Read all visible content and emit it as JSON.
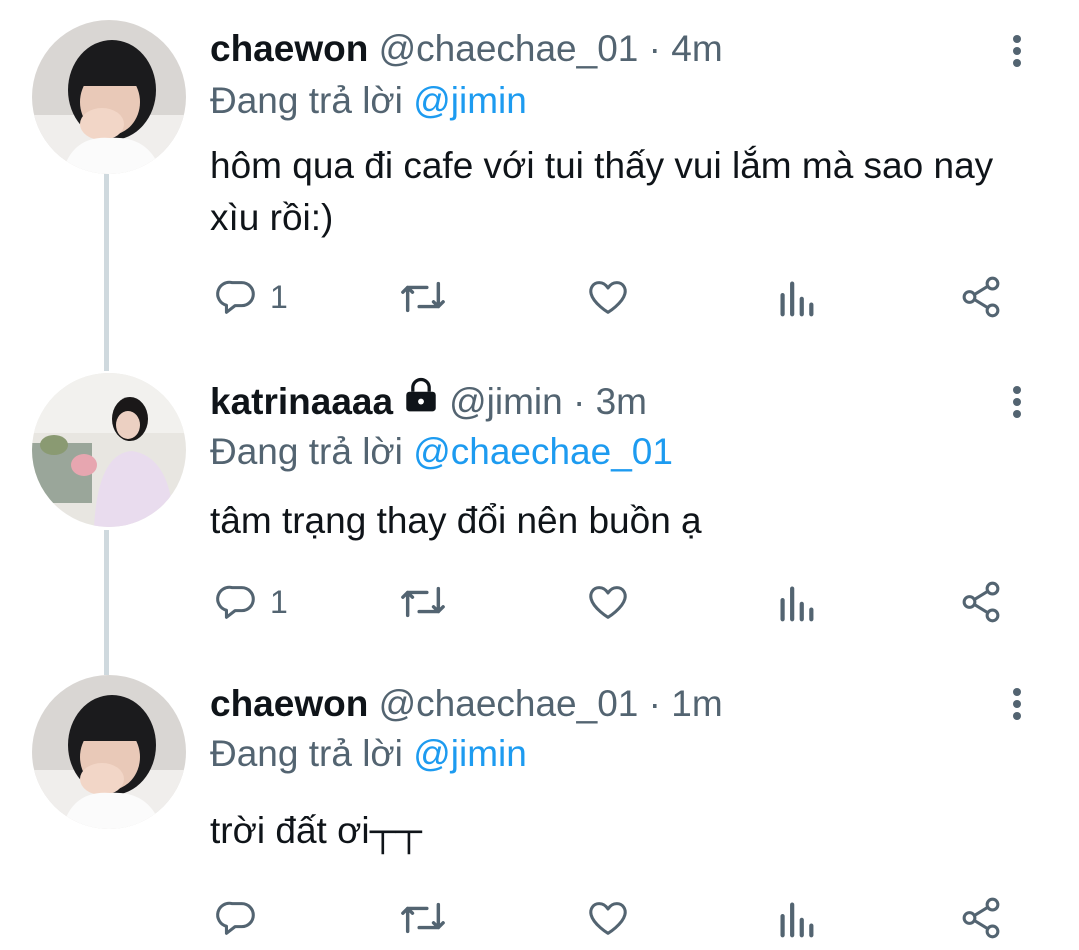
{
  "thread": [
    {
      "display_name": "chaewon",
      "handle": "@chaechae_01",
      "separator": "·",
      "time": "4m",
      "protected": false,
      "reply_prefix": "Đang trả lời",
      "reply_to": "@jimin",
      "text": "hôm qua đi cafe với tui thấy vui lắm mà sao nay xìu rồi:)",
      "reply_count": "1"
    },
    {
      "display_name": "katrinaaaa",
      "handle": "@jimin",
      "separator": "·",
      "time": "3m",
      "protected": true,
      "reply_prefix": "Đang trả lời",
      "reply_to": "@chaechae_01",
      "text": "tâm trạng thay đổi nên buồn ạ",
      "reply_count": "1"
    },
    {
      "display_name": "chaewon",
      "handle": "@chaechae_01",
      "separator": "·",
      "time": "1m",
      "protected": false,
      "reply_prefix": "Đang trả lời",
      "reply_to": "@jimin",
      "text": "trời đất ơi┬┬",
      "reply_count": ""
    }
  ],
  "icons": {
    "reply": "reply-icon",
    "retweet": "retweet-icon",
    "like": "heart-icon",
    "stats": "analytics-icon",
    "share": "share-icon",
    "more": "more-vertical-icon",
    "lock": "lock-icon"
  },
  "colors": {
    "text_primary": "#0f1419",
    "text_secondary": "#536471",
    "mention": "#1d9bf0",
    "thread_line": "#cfd9de"
  }
}
